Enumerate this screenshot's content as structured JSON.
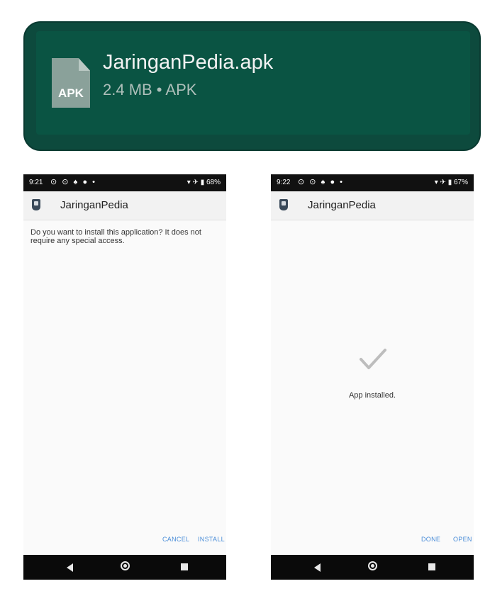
{
  "download": {
    "file_icon_label": "APK",
    "filename": "JaringanPedia.apk",
    "meta": "2.4 MB • APK"
  },
  "left_phone": {
    "status_time": "9:21",
    "status_icons": "⊙ ⊙ ♠ ● •",
    "status_right": "▾ ✈ ▮ 68%",
    "app_title": "JaringanPedia",
    "prompt": "Do you want to install this application? It does not require any special access.",
    "cancel_label": "CANCEL",
    "install_label": "INSTALL"
  },
  "right_phone": {
    "status_time": "9:22",
    "status_icons": "⊙ ⊙ ♠ ● •",
    "status_right": "▾ ✈ ▮ 67%",
    "app_title": "JaringanPedia",
    "installed_message": "App installed.",
    "done_label": "DONE",
    "open_label": "OPEN"
  },
  "icons": {
    "file": "apk-file-icon",
    "app": "app-icon",
    "check": "checkmark-icon",
    "back": "back-triangle-icon",
    "home": "home-circle-icon",
    "recent": "recent-square-icon"
  },
  "colors": {
    "notification_bg": "#0d4a3d",
    "button_text": "#4a8dd8",
    "status_bar": "#111111",
    "nav_bar": "#0a0a0a"
  }
}
